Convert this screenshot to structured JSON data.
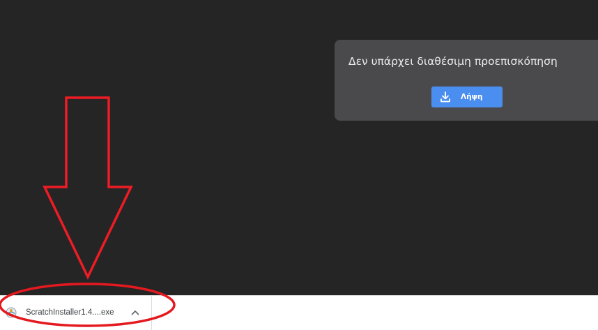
{
  "viewer": {
    "no_preview_text": "Δεν υπάρχει διαθέσιμη προεπισκόπηση",
    "download_button": {
      "label": "Λήψη",
      "icon": "download-icon"
    }
  },
  "download_shelf": {
    "items": [
      {
        "file_name": "ScratchInstaller1.4....exe",
        "icon": "installer-file-icon",
        "menu_icon": "chevron-up-icon"
      }
    ]
  },
  "annotations": {
    "arrow_color": "#ee1c24",
    "ellipse_color": "#e4191f"
  },
  "colors": {
    "viewer_background": "#252525",
    "card_background": "#4a4a4d",
    "button_accent": "#4a8ef0",
    "shelf_background": "#ffffff"
  }
}
